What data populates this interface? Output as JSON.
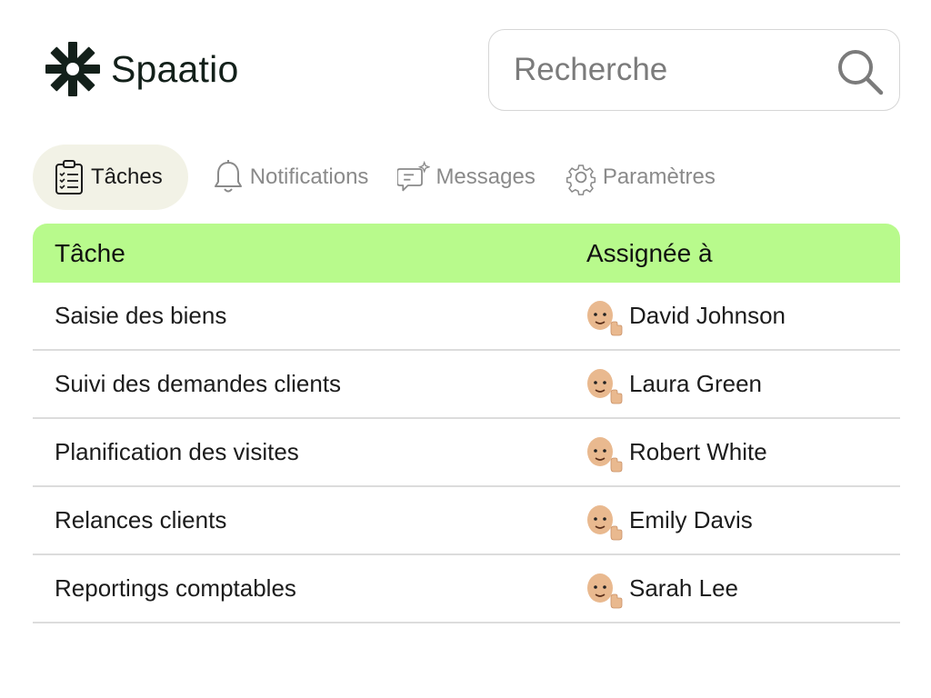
{
  "brand": {
    "name": "Spaatio",
    "accent": "#b8fa8c",
    "logo_color": "#13201a"
  },
  "search": {
    "placeholder": "Recherche",
    "value": ""
  },
  "tabs": [
    {
      "label": "Tâches",
      "icon": "clipboard-list-icon",
      "active": true
    },
    {
      "label": "Notifications",
      "icon": "bell-icon",
      "active": false
    },
    {
      "label": "Messages",
      "icon": "chat-sparkle-icon",
      "active": false
    },
    {
      "label": "Paramètres",
      "icon": "gear-icon",
      "active": false
    }
  ],
  "table": {
    "headers": {
      "task": "Tâche",
      "assignee": "Assignée à"
    },
    "rows": [
      {
        "task": "Saisie des biens",
        "assignee": "David Johnson",
        "avatar": "memoji-thumbs-up-icon"
      },
      {
        "task": "Suivi des demandes clients",
        "assignee": "Laura Green",
        "avatar": "memoji-thumbs-up-icon"
      },
      {
        "task": "Planification des visites",
        "assignee": "Robert White",
        "avatar": "memoji-thumbs-up-icon"
      },
      {
        "task": "Relances clients",
        "assignee": "Emily Davis",
        "avatar": "memoji-thumbs-up-icon"
      },
      {
        "task": "Reportings comptables",
        "assignee": "Sarah Lee",
        "avatar": "memoji-thumbs-up-icon"
      }
    ]
  }
}
